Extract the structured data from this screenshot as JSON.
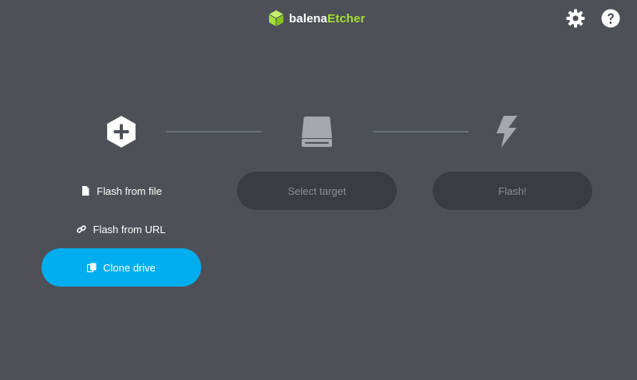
{
  "header": {
    "brand_part1": "balena",
    "brand_part2": "Etcher",
    "settings_icon": "gear-icon",
    "help_icon": "question-circle-icon"
  },
  "steps": {
    "source": {
      "icon": "plus-hexagon-icon",
      "options": [
        {
          "label": "Flash from file",
          "icon": "file-icon"
        },
        {
          "label": "Flash from URL",
          "icon": "link-icon"
        },
        {
          "label": "Clone drive",
          "icon": "copy-icon"
        }
      ]
    },
    "target": {
      "icon": "drive-icon",
      "button_label": "Select target"
    },
    "flash": {
      "icon": "lightning-bolt-icon",
      "button_label": "Flash!"
    }
  },
  "colors": {
    "background": "#4d5057",
    "accent": "#00aeef",
    "brand_green": "#a5de37",
    "disabled_button": "#3a3c41",
    "disabled_text": "#8b8e94"
  }
}
